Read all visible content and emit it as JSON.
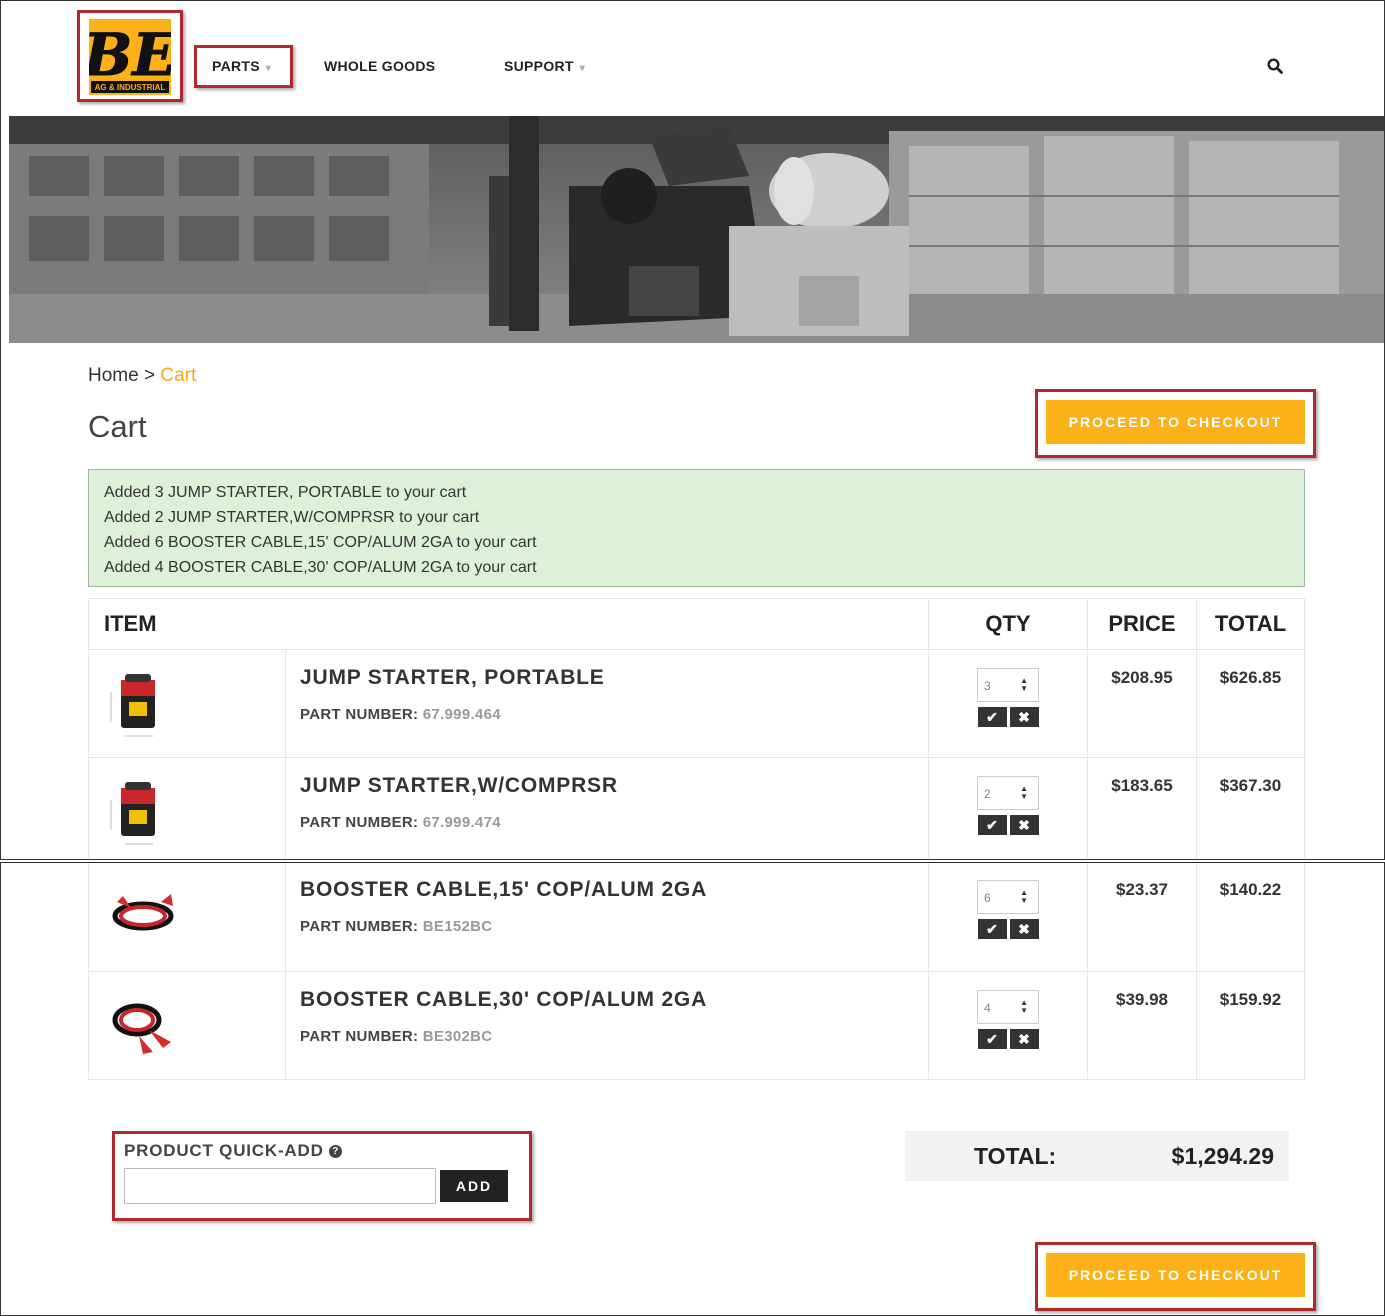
{
  "brand": {
    "logo_text": "BE",
    "logo_subtext": "AG & INDUSTRIAL",
    "accent": "#fbb117",
    "highlight": "#b3282d"
  },
  "nav": {
    "items": [
      {
        "label": "PARTS",
        "has_dropdown": true
      },
      {
        "label": "WHOLE GOODS",
        "has_dropdown": false
      },
      {
        "label": "SUPPORT",
        "has_dropdown": true
      }
    ],
    "search_icon": "search-icon"
  },
  "breadcrumb": {
    "home": "Home",
    "sep": ">",
    "current": "Cart"
  },
  "page_title": "Cart",
  "checkout_label": "PROCEED TO CHECKOUT",
  "alert_messages": [
    "Added 3 JUMP STARTER, PORTABLE to your cart",
    "Added 2 JUMP STARTER,W/COMPRSR to your cart",
    "Added 6 BOOSTER CABLE,15' COP/ALUM 2GA to your cart",
    "Added 4 BOOSTER CABLE,30' COP/ALUM 2GA to your cart"
  ],
  "table": {
    "headers": {
      "item": "ITEM",
      "qty": "QTY",
      "price": "PRICE",
      "total": "TOTAL"
    },
    "part_label": "PART NUMBER:",
    "rows": [
      {
        "name": "JUMP STARTER, PORTABLE",
        "part": "67.999.464",
        "qty": "3",
        "price": "$208.95",
        "total": "$626.85",
        "image": "jump-starter"
      },
      {
        "name": "JUMP STARTER,W/COMPRSR",
        "part": "67.999.474",
        "qty": "2",
        "price": "$183.65",
        "total": "$367.30",
        "image": "jump-starter"
      },
      {
        "name": "BOOSTER CABLE,15' COP/ALUM 2GA",
        "part": "BE152BC",
        "qty": "6",
        "price": "$23.37",
        "total": "$140.22",
        "image": "booster-cable"
      },
      {
        "name": "BOOSTER CABLE,30' COP/ALUM 2GA",
        "part": "BE302BC",
        "qty": "4",
        "price": "$39.98",
        "total": "$159.92",
        "image": "booster-cable"
      }
    ]
  },
  "quick_add": {
    "label": "PRODUCT QUICK-ADD",
    "help_icon": "help-icon",
    "value": "",
    "button": "ADD"
  },
  "summary": {
    "total_label": "TOTAL:",
    "total_value": "$1,294.29"
  }
}
